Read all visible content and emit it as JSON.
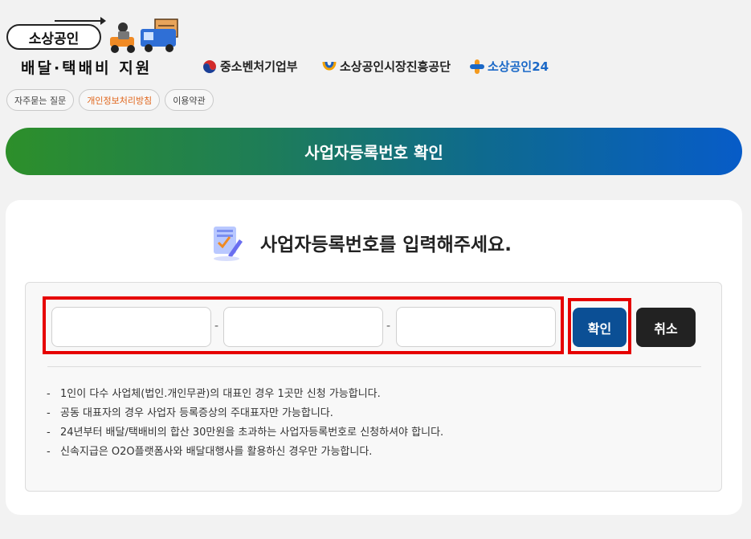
{
  "brand": {
    "pill_text": "소상공인",
    "subtitle": "배달·택배비 지원",
    "truck_icon": "delivery-truck-icon"
  },
  "partners": [
    {
      "name": "중소벤처기업부",
      "icon": "taegeuk-icon"
    },
    {
      "name": "소상공인시장진흥공단",
      "icon": "semas-logo-icon"
    },
    {
      "name": "소상공인24",
      "icon": "plus-logo-icon"
    }
  ],
  "top_links": [
    {
      "label": "자주묻는 질문"
    },
    {
      "label": "개인정보처리방침"
    },
    {
      "label": "이용약관"
    }
  ],
  "banner": {
    "title": "사업자등록번호 확인"
  },
  "form": {
    "heading": "사업자등록번호를 입력해주세요.",
    "heading_icon": "document-pen-icon",
    "field1": {
      "value": "",
      "placeholder": ""
    },
    "field2": {
      "value": "",
      "placeholder": ""
    },
    "field3": {
      "value": "",
      "placeholder": ""
    },
    "separator": "-",
    "confirm_label": "확인",
    "cancel_label": "취소"
  },
  "notes": [
    {
      "bullet": "-",
      "text": "1인이 다수 사업체(법인.개인무관)의 대표인 경우 1곳만 신청 가능합니다."
    },
    {
      "bullet": "-",
      "text": "공동 대표자의 경우 사업자 등록증상의 주대표자만 가능합니다."
    },
    {
      "bullet": "-",
      "text": "24년부터 배달/택배비의 합산 30만원을 초과하는 사업자등록번호로 신청하셔야 합니다."
    },
    {
      "bullet": "-",
      "text": "신속지급은 O2O플랫폼사와 배달대행사를 활용하신 경우만 가능합니다."
    }
  ],
  "colors": {
    "banner_start": "#2d8f2a",
    "banner_end": "#075cc8",
    "confirm_button": "#0b4f95",
    "cancel_button": "#222222",
    "highlight": "#e60000",
    "accent_link": "#e0661c"
  }
}
